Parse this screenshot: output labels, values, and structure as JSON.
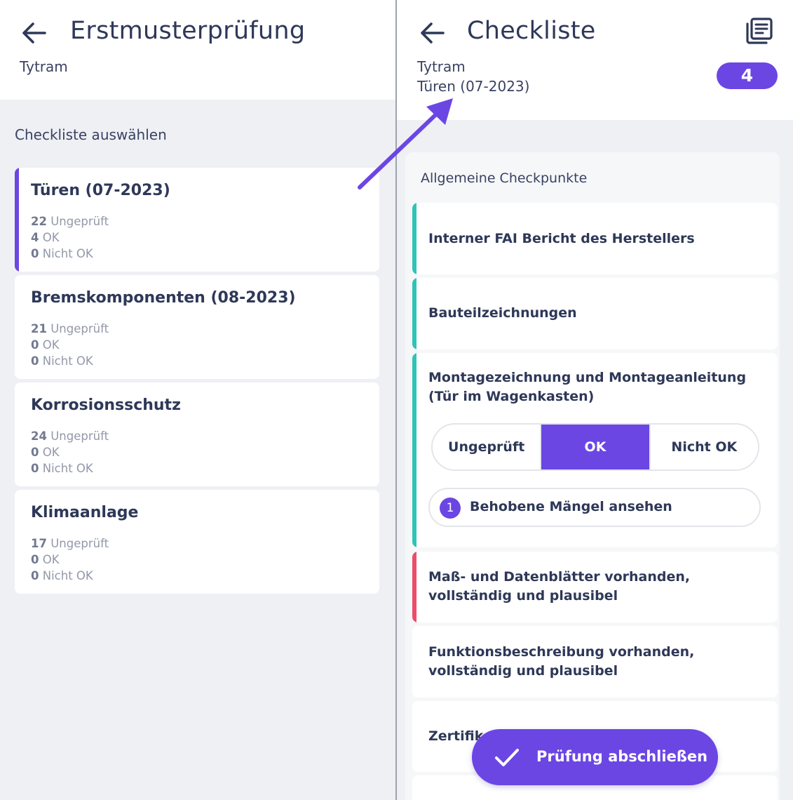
{
  "left_screen": {
    "header": {
      "title": "Erstmusterprüfung",
      "subtitle": "Tytram"
    },
    "section_title": "Checkliste auswählen",
    "checklists": [
      {
        "name": "Türen (07-2023)",
        "unchecked_count": "22",
        "unchecked_label": "Ungeprüft",
        "ok_count": "4",
        "ok_label": "OK",
        "not_ok_count": "0",
        "not_ok_label": "Nicht OK"
      },
      {
        "name": "Bremskomponenten (08-2023)",
        "unchecked_count": "21",
        "unchecked_label": "Ungeprüft",
        "ok_count": "0",
        "ok_label": "OK",
        "not_ok_count": "0",
        "not_ok_label": "Nicht OK"
      },
      {
        "name": "Korrosionsschutz",
        "unchecked_count": "24",
        "unchecked_label": "Ungeprüft",
        "ok_count": "0",
        "ok_label": "OK",
        "not_ok_count": "0",
        "not_ok_label": "Nicht OK"
      },
      {
        "name": "Klimaanlage",
        "unchecked_count": "17",
        "unchecked_label": "Ungeprüft",
        "ok_count": "0",
        "ok_label": "OK",
        "not_ok_count": "0",
        "not_ok_label": "Nicht OK"
      }
    ]
  },
  "right_screen": {
    "header": {
      "title": "Checkliste",
      "subtitle_1": "Tytram",
      "subtitle_2": "Türen (07-2023)",
      "badge": "4"
    },
    "group_title": "Allgemeine Checkpunkte",
    "items": [
      {
        "title": "Interner FAI Bericht des Herstellers",
        "status_color": "#2ec4b6"
      },
      {
        "title": "Bauteilzeichnungen",
        "status_color": "#2ec4b6"
      },
      {
        "title": "Montagezeichnung und Montageanleitung (Tür im Wagenkasten)",
        "status_color": "#2ec4b6"
      },
      {
        "title": "Maß- und Datenblätter vorhanden, vollständig und plausibel",
        "status_color": "#ec4d6b"
      },
      {
        "title": "Funktionsbeschreibung vorhanden, vollständig und plausibel"
      },
      {
        "title": "Zertifik"
      }
    ],
    "status_options": [
      "Ungeprüft",
      "OK",
      "Nicht OK"
    ],
    "selected_status": "OK",
    "defects": {
      "count": "1",
      "label": "Behobene Mängel ansehen"
    },
    "fab_label": "Prüfung abschließen"
  },
  "icons": [
    "back-arrow-icon",
    "list-icon",
    "check-icon"
  ],
  "colors": {
    "accent": "#6b46e3",
    "ok": "#2ec4b6",
    "not_ok": "#ec4d6b",
    "text": "#2e3858"
  }
}
